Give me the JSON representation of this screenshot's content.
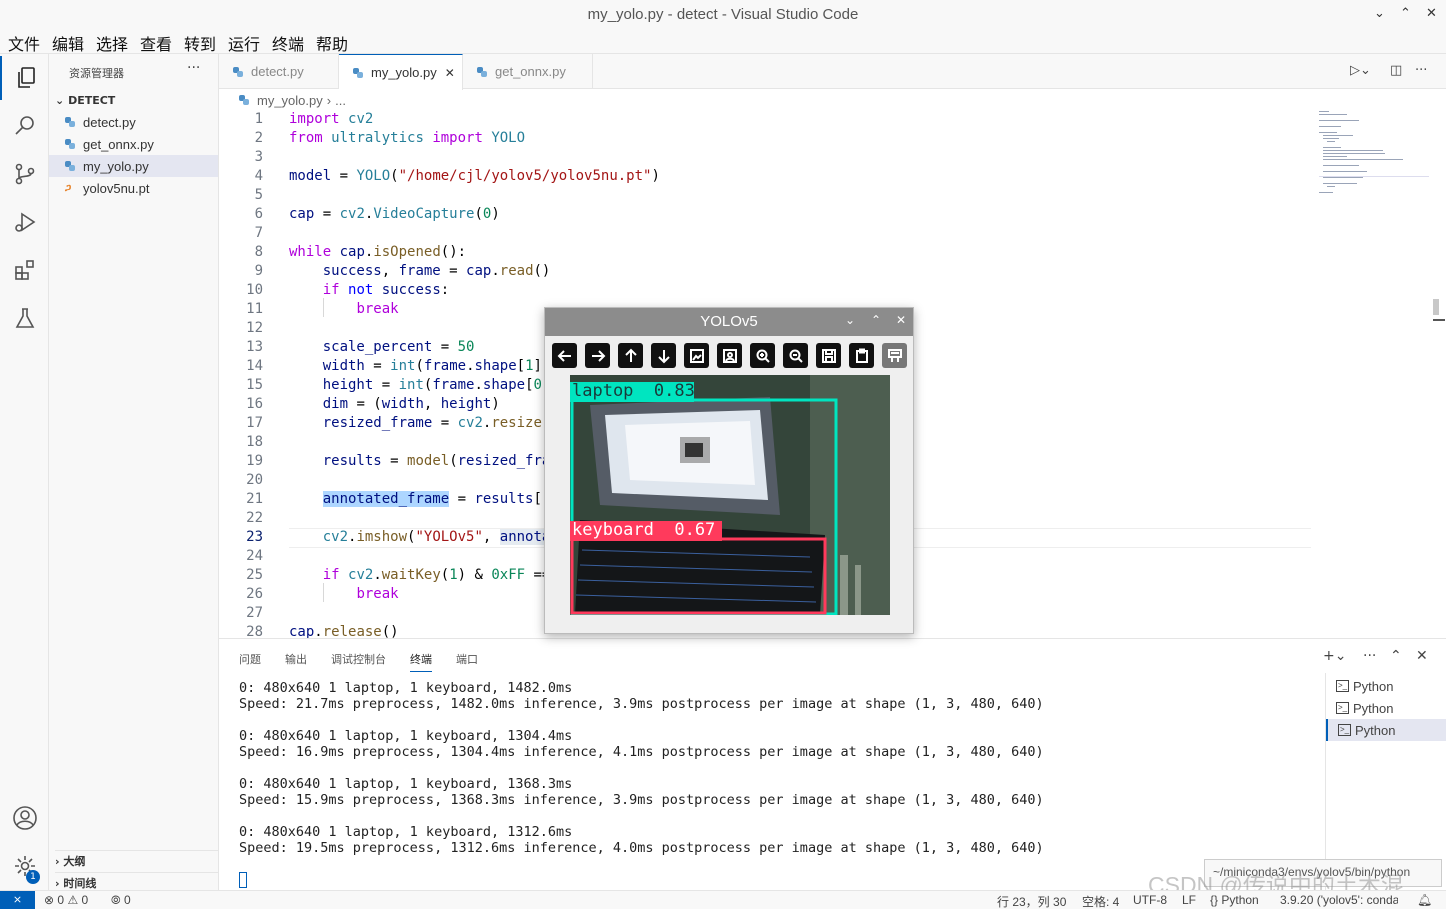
{
  "window": {
    "title": "my_yolo.py - detect - Visual Studio Code"
  },
  "menu": [
    "文件",
    "编辑",
    "选择",
    "查看",
    "转到",
    "运行",
    "终端",
    "帮助"
  ],
  "sidebar": {
    "header": "资源管理器",
    "section": "DETECT",
    "files": [
      {
        "name": "detect.py",
        "type": "py"
      },
      {
        "name": "get_onnx.py",
        "type": "py"
      },
      {
        "name": "my_yolo.py",
        "type": "py",
        "selected": true
      },
      {
        "name": "yolov5nu.pt",
        "type": "pt"
      }
    ],
    "outline": "大纲",
    "timeline": "时间线",
    "accounts_badge": "1"
  },
  "tabs": [
    {
      "label": "detect.py"
    },
    {
      "label": "my_yolo.py",
      "active": true,
      "close": "✕"
    },
    {
      "label": "get_onnx.py"
    }
  ],
  "breadcrumb": {
    "file": "my_yolo.py",
    "rest": "..."
  },
  "editor": {
    "current_line": 23,
    "line_numbers": [
      "1",
      "2",
      "3",
      "4",
      "5",
      "6",
      "7",
      "8",
      "9",
      "10",
      "11",
      "12",
      "13",
      "14",
      "15",
      "16",
      "17",
      "18",
      "19",
      "20",
      "21",
      "22",
      "23",
      "24",
      "25",
      "26",
      "27",
      "28"
    ]
  },
  "cv_window": {
    "title": "YOLOv5",
    "detections": [
      {
        "label": "laptop  0.83",
        "color": "#00e5c0"
      },
      {
        "label": "keyboard  0.67",
        "color": "#ff3a5c"
      }
    ]
  },
  "panel": {
    "tabs": [
      "问题",
      "输出",
      "调试控制台",
      "终端",
      "端口"
    ],
    "active_tab": "终端",
    "terminal_lines": [
      "0: 480x640 1 laptop, 1 keyboard, 1482.0ms",
      "Speed: 21.7ms preprocess, 1482.0ms inference, 3.9ms postprocess per image at shape (1, 3, 480, 640)",
      "0: 480x640 1 laptop, 1 keyboard, 1304.4ms",
      "Speed: 16.9ms preprocess, 1304.4ms inference, 4.1ms postprocess per image at shape (1, 3, 480, 640)",
      "0: 480x640 1 laptop, 1 keyboard, 1368.3ms",
      "Speed: 15.9ms preprocess, 1368.3ms inference, 3.9ms postprocess per image at shape (1, 3, 480, 640)",
      "0: 480x640 1 laptop, 1 keyboard, 1312.6ms",
      "Speed: 19.5ms preprocess, 1312.6ms inference, 4.0ms postprocess per image at shape (1, 3, 480, 640)"
    ],
    "terminals": [
      "Python",
      "Python",
      "Python"
    ],
    "tooltip": "~/miniconda3/envs/yolov5/bin/python"
  },
  "statusbar": {
    "errors": "0",
    "warnings": "0",
    "ports": "0",
    "position": "行 23，列 30",
    "spaces": "空格: 4",
    "encoding": "UTF-8",
    "eol": "LF",
    "language": "Python",
    "interpreter": "3.9.20 ('yolov5': conda)"
  },
  "watermark": "CSDN @传说中的土木混",
  "colors": {
    "accent": "#005fb8"
  }
}
